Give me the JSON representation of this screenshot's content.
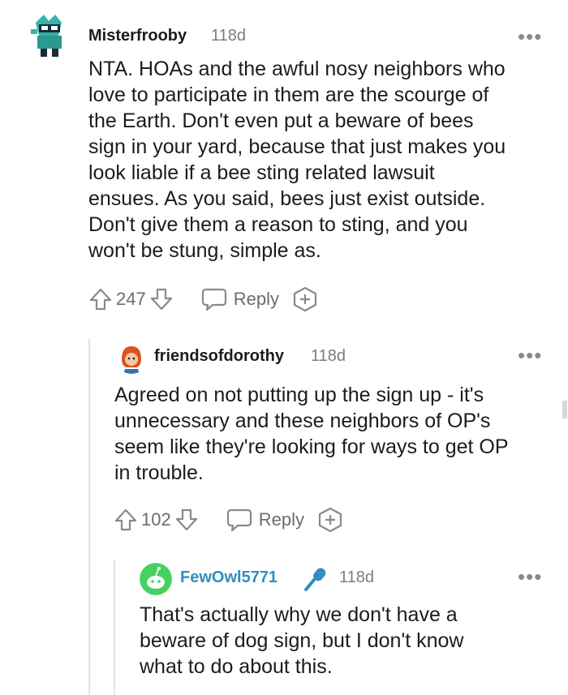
{
  "comments": [
    {
      "username": "Misterfrooby",
      "timestamp": "118d",
      "more_label": "•••",
      "lines": [
        "NTA. HOAs and the awful nosy neighbors who",
        "love to participate in them are the scourge of",
        "the Earth. Don't even put a beware of bees",
        "sign in your yard, because that just makes you",
        "look liable if a bee sting related lawsuit",
        "ensues. As you said, bees just exist outside.",
        "Don't give them a reason to sting, and you",
        "won't be stung, simple as."
      ],
      "score": "247",
      "reply_label": "Reply"
    },
    {
      "username": "friendsofdorothy",
      "timestamp": "118d",
      "more_label": "•••",
      "lines": [
        "Agreed on not putting up the sign up - it's",
        "unnecessary and these neighbors of OP's",
        "seem like they're looking for ways to get OP",
        "in trouble."
      ],
      "score": "102",
      "reply_label": "Reply"
    },
    {
      "username": "FewOwl5771",
      "timestamp": "118d",
      "more_label": "•••",
      "lines": [
        "That's actually why we don't have a",
        "beware of dog sign, but I don't know",
        "what to do about this."
      ]
    }
  ],
  "icons": {
    "upvote": "arrow-up-icon",
    "downvote": "arrow-down-icon",
    "reply": "speech-bubble-icon",
    "award": "award-plus-icon",
    "more": "more-dots-icon",
    "flair": "microphone-icon"
  },
  "colors": {
    "text": "#1c1c1c",
    "meta": "#7c7c7c",
    "icon": "#878a8c",
    "thread_line": "#e3e3e3",
    "flair_blue": "#2f8fbf",
    "snoo_green": "#46d160"
  }
}
